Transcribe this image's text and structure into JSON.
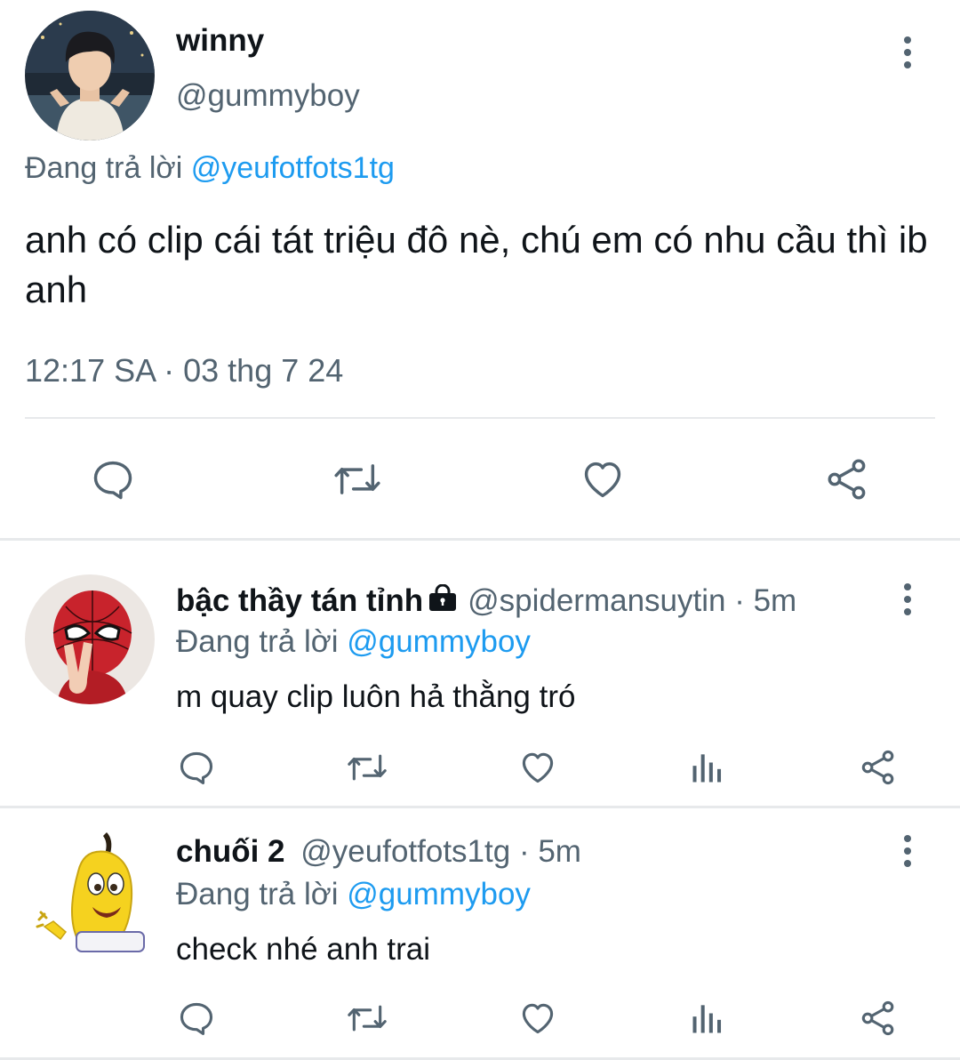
{
  "main_tweet": {
    "display_name": "winny",
    "handle": "@gummyboy",
    "replying_prefix": "Đang trả lời",
    "replying_to": "@yeufotfots1tg",
    "text": "anh có clip cái tát triệu đô nè, chú em có nhu cầu thì ib anh",
    "timestamp": "12:17 SA · 03 thg 7 24",
    "actions": [
      "reply-icon",
      "retweet-icon",
      "like-icon",
      "share-icon"
    ]
  },
  "replies": [
    {
      "display_name": "bậc thầy tán tỉnh",
      "protected_icon": "lock-icon",
      "handle": "@spidermansuytin",
      "time": "· 5m",
      "replying_prefix": "Đang trả lời",
      "replying_to": "@gummyboy",
      "text": "m quay clip luôn hả thằng tró",
      "actions": [
        "reply-icon",
        "retweet-icon",
        "like-icon",
        "views-icon",
        "share-icon"
      ]
    },
    {
      "display_name": "chuối 2",
      "handle": "@yeufotfots1tg",
      "time": "· 5m",
      "replying_prefix": "Đang trả lời",
      "replying_to": "@gummyboy",
      "text": "check nhé anh trai",
      "actions": [
        "reply-icon",
        "retweet-icon",
        "like-icon",
        "views-icon",
        "share-icon"
      ]
    }
  ],
  "colors": {
    "text": "#0f1419",
    "secondary": "#536471",
    "accent": "#1d9bf0",
    "divider": "#e7e9eb"
  }
}
